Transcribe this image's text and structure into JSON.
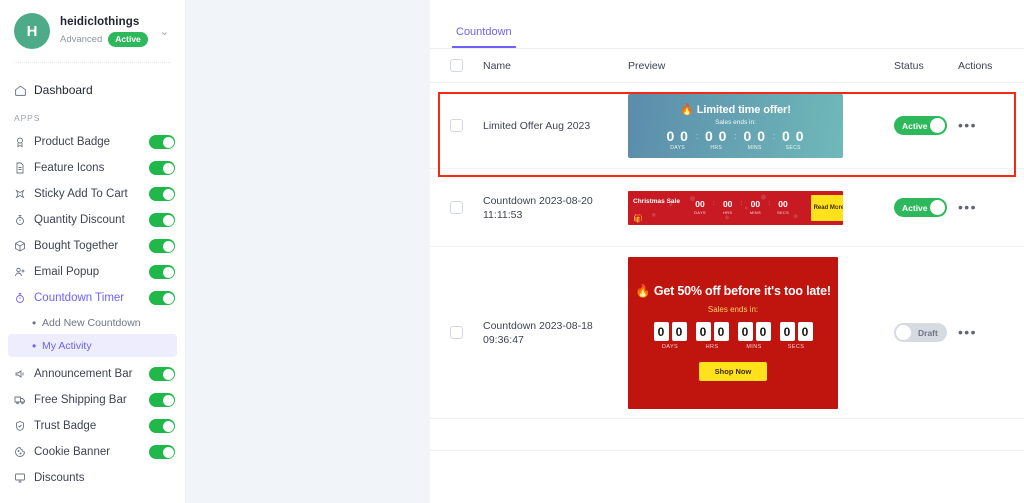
{
  "sidebar": {
    "store": {
      "avatar_letter": "H",
      "name": "heidiclothings",
      "plan": "Advanced",
      "status": "Active",
      "chevron": "chevron-down"
    },
    "dashboard_label": "Dashboard",
    "apps_heading": "APPS",
    "apps": [
      {
        "label": "Product Badge",
        "icon": "badge-icon",
        "toggle": "on"
      },
      {
        "label": "Feature Icons",
        "icon": "document-icon",
        "toggle": "on"
      },
      {
        "label": "Sticky Add To Cart",
        "icon": "pin-icon",
        "toggle": "on"
      },
      {
        "label": "Quantity Discount",
        "icon": "stopwatch-icon",
        "toggle": "on"
      },
      {
        "label": "Bought Together",
        "icon": "box-icon",
        "toggle": "on"
      },
      {
        "label": "Email Popup",
        "icon": "user-plus-icon",
        "toggle": "on"
      },
      {
        "label": "Countdown Timer",
        "icon": "stopwatch-icon",
        "toggle": "on"
      }
    ],
    "countdown_subitems": [
      {
        "label": "Add New Countdown",
        "selected": false
      },
      {
        "label": "My Activity",
        "selected": true
      }
    ],
    "apps_after": [
      {
        "label": "Announcement Bar",
        "icon": "megaphone-icon",
        "toggle": "on"
      },
      {
        "label": "Free Shipping Bar",
        "icon": "truck-icon",
        "toggle": "on"
      },
      {
        "label": "Trust Badge",
        "icon": "shield-icon",
        "toggle": "on"
      },
      {
        "label": "Cookie Banner",
        "icon": "cookie-icon",
        "toggle": "on"
      },
      {
        "label": "Discounts",
        "icon": "monitor-icon",
        "toggle": "none"
      }
    ]
  },
  "main": {
    "tab": "Countdown",
    "table": {
      "headers": {
        "name": "Name",
        "preview": "Preview",
        "status": "Status",
        "actions": "Actions"
      },
      "rows": [
        {
          "name": "Limited Offer Aug 2023",
          "status": "Active",
          "status_state": "on",
          "actions": "•••",
          "highlighted": true,
          "preview": {
            "style": "gradient-card",
            "title": "🔥 Limited time offer!",
            "subtitle": "Sales ends in:",
            "units": [
              {
                "value": "0 0",
                "label": "DAYS"
              },
              {
                "value": "0 0",
                "label": "HRS"
              },
              {
                "value": "0 0",
                "label": "MINS"
              },
              {
                "value": "0 0",
                "label": "SECS"
              }
            ],
            "gradient_from": "#5b8cab",
            "gradient_to": "#6fb9b9"
          }
        },
        {
          "name": "Countdown 2023-08-20\n11:11:53",
          "status": "Active",
          "status_state": "on",
          "actions": "•••",
          "highlighted": false,
          "preview": {
            "style": "christmas-bar",
            "title": "Christmas Sale",
            "emoji": "🎁",
            "units": [
              {
                "value": "00",
                "label": "DAYS"
              },
              {
                "value": "00",
                "label": "HRS"
              },
              {
                "value": "00",
                "label": "MINS"
              },
              {
                "value": "00",
                "label": "SECS"
              }
            ],
            "button": "Read More",
            "close": "×",
            "bg_color": "#c81a22",
            "button_color": "#ffe11c"
          }
        },
        {
          "name": "Countdown 2023-08-18\n09:36:47",
          "status": "Draft",
          "status_state": "off",
          "actions": "•••",
          "highlighted": false,
          "preview": {
            "style": "red-card",
            "title": "🔥 Get 50% off before it's too late!",
            "subtitle": "Sales ends in:",
            "units": [
              {
                "digits": [
                  "0",
                  "0"
                ],
                "label": "DAYS"
              },
              {
                "digits": [
                  "0",
                  "0"
                ],
                "label": "HRS"
              },
              {
                "digits": [
                  "0",
                  "0"
                ],
                "label": "MINS"
              },
              {
                "digits": [
                  "0",
                  "0"
                ],
                "label": "SECS"
              }
            ],
            "button": "Shop Now",
            "bg_color": "#c0140f",
            "button_color": "#ffe11c"
          }
        }
      ]
    }
  },
  "colors": {
    "accent": "#6c63f5",
    "toggle_on": "#20b84a",
    "status_on": "#2eb85c",
    "status_off": "#d6dae1",
    "highlight_border": "#f42a14",
    "page_bg": "#f1f4f8"
  }
}
